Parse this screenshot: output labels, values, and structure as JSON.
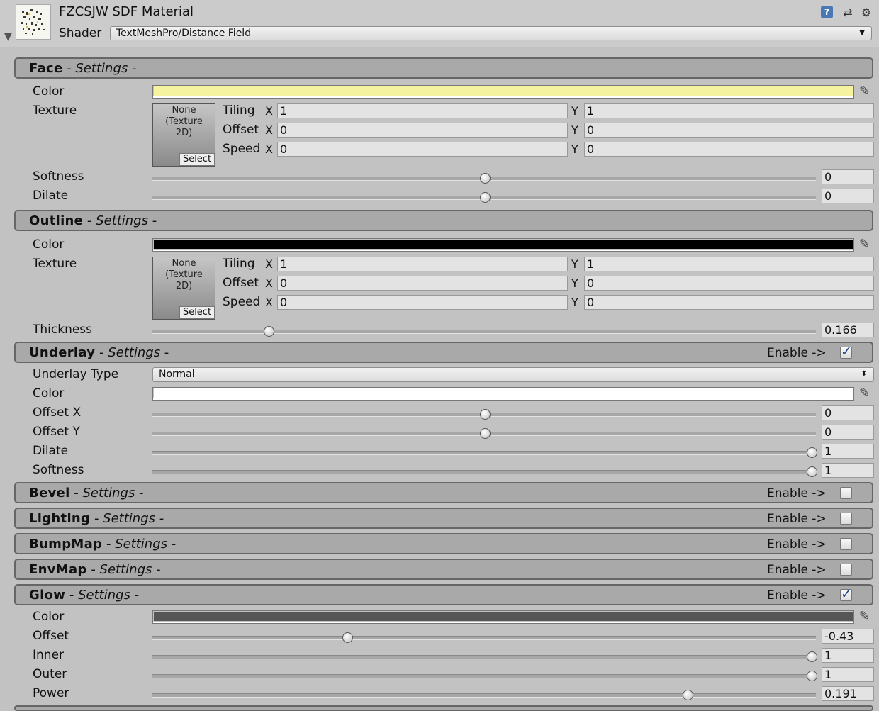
{
  "header": {
    "title": "FZCSJW SDF Material",
    "shader_label": "Shader",
    "shader_value": "TextMeshPro/Distance Field"
  },
  "sections": {
    "face": {
      "bold": "Face",
      "dash": " - ",
      "italic": "Settings",
      "tail": " -"
    },
    "outline": {
      "bold": "Outline",
      "dash": " - ",
      "italic": "Settings",
      "tail": " -"
    },
    "underlay": {
      "bold": "Underlay",
      "dash": " - ",
      "italic": "Settings",
      "tail": " -",
      "enable": "Enable ->",
      "checked": true
    },
    "bevel": {
      "bold": "Bevel",
      "dash": " - ",
      "italic": "Settings",
      "tail": " -",
      "enable": "Enable ->",
      "checked": false
    },
    "lighting": {
      "bold": "Lighting",
      "dash": " - ",
      "italic": "Settings",
      "tail": " -",
      "enable": "Enable ->",
      "checked": false
    },
    "bumpmap": {
      "bold": "BumpMap",
      "dash": " - ",
      "italic": "Settings",
      "tail": " -",
      "enable": "Enable ->",
      "checked": false
    },
    "envmap": {
      "bold": "EnvMap",
      "dash": " - ",
      "italic": "Settings",
      "tail": " -",
      "enable": "Enable ->",
      "checked": false
    },
    "glow": {
      "bold": "Glow",
      "dash": " - ",
      "italic": "Settings",
      "tail": " -",
      "enable": "Enable ->",
      "checked": true
    }
  },
  "face": {
    "color_label": "Color",
    "color": "#f6f3a0",
    "texture_label": "Texture",
    "texture": {
      "line1": "None",
      "line2": "(Texture",
      "line3": "2D)",
      "select": "Select"
    },
    "tiling": {
      "label": "Tiling",
      "x": "1",
      "y": "1"
    },
    "offset": {
      "label": "Offset",
      "x": "0",
      "y": "0"
    },
    "speed": {
      "label": "Speed",
      "x": "0",
      "y": "0"
    },
    "softness": {
      "label": "Softness",
      "value": "0",
      "fraction": 0.5
    },
    "dilate": {
      "label": "Dilate",
      "value": "0",
      "fraction": 0.5
    }
  },
  "outline": {
    "color_label": "Color",
    "color": "#000000",
    "texture_label": "Texture",
    "texture": {
      "line1": "None",
      "line2": "(Texture",
      "line3": "2D)",
      "select": "Select"
    },
    "tiling": {
      "label": "Tiling",
      "x": "1",
      "y": "1"
    },
    "offset": {
      "label": "Offset",
      "x": "0",
      "y": "0"
    },
    "speed": {
      "label": "Speed",
      "x": "0",
      "y": "0"
    },
    "thickness": {
      "label": "Thickness",
      "value": "0.166",
      "fraction": 0.17
    }
  },
  "underlay": {
    "type_label": "Underlay Type",
    "type_value": "Normal",
    "color_label": "Color",
    "color": "#ffffff",
    "offset_x": {
      "label": "Offset X",
      "value": "0",
      "fraction": 0.5
    },
    "offset_y": {
      "label": "Offset Y",
      "value": "0",
      "fraction": 0.5
    },
    "dilate": {
      "label": "Dilate",
      "value": "1",
      "fraction": 1.0
    },
    "softness": {
      "label": "Softness",
      "value": "1",
      "fraction": 1.0
    }
  },
  "glow": {
    "color_label": "Color",
    "color": "#565656",
    "offset": {
      "label": "Offset",
      "value": "-0.43",
      "fraction": 0.29
    },
    "inner": {
      "label": "Inner",
      "value": "1",
      "fraction": 1.0
    },
    "outer": {
      "label": "Outer",
      "value": "1",
      "fraction": 1.0
    },
    "power": {
      "label": "Power",
      "value": "0.191",
      "fraction": 0.81
    }
  },
  "axis": {
    "x": "X",
    "y": "Y"
  }
}
